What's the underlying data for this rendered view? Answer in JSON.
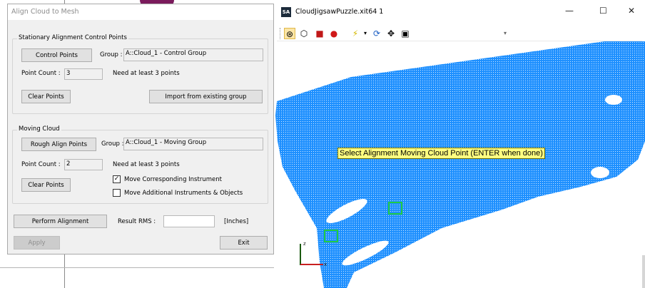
{
  "dialog": {
    "title": "Align Cloud to Mesh",
    "stationary": {
      "title": "Stationary Alignment Control Points",
      "control_points_btn": "Control Points",
      "group_label": "Group :",
      "group_value": "A::Cloud_1 - Control Group",
      "point_count_label": "Point Count :",
      "point_count_value": "3",
      "need_text": "Need at least 3 points",
      "clear_btn": "Clear Points",
      "import_btn": "Import from existing group"
    },
    "moving": {
      "title": "Moving Cloud",
      "rough_btn": "Rough Align Points",
      "group_label": "Group :",
      "group_value": "A::Cloud_1 - Moving Group",
      "point_count_label": "Point Count :",
      "point_count_value": "2",
      "need_text": "Need at least 3 points",
      "clear_btn": "Clear Points",
      "move_instrument_label": "Move Corresponding Instrument",
      "move_instrument_checked": true,
      "move_additional_label": "Move Additional Instruments & Objects",
      "move_additional_checked": false
    },
    "perform_btn": "Perform Alignment",
    "result_rms_label": "Result RMS :",
    "result_rms_value": "",
    "units": "[Inches]",
    "apply_btn": "Apply",
    "exit_btn": "Exit"
  },
  "window": {
    "app_icon": "SA",
    "title": "CloudJigsawPuzzle.xit64 1",
    "minimize": "—",
    "maximize": "☐",
    "close": "✕",
    "toolbar_icons": [
      "cube-wireframe-icon",
      "cube-outline-icon",
      "cube-red-icon",
      "sphere-red-icon",
      "lightning-icon",
      "dropdown-arrow-icon",
      "rotate-icon",
      "move-icon",
      "camera-icon"
    ]
  },
  "viewport": {
    "hint": "Select Alignment Moving Cloud Point (ENTER when done)",
    "cloud_color": "#1e90ff",
    "marker_color": "#22cc44",
    "axis_z": "z",
    "axis_x": "x"
  }
}
